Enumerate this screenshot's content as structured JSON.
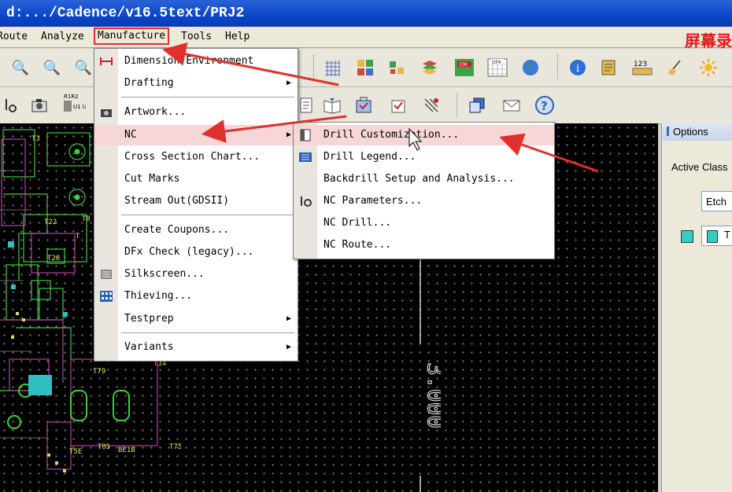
{
  "window": {
    "title": "d:.../Cadence/v16.5text/PRJ2"
  },
  "menubar": {
    "items": [
      "Route",
      "Analyze",
      "Manufacture",
      "Tools",
      "Help"
    ],
    "active": "Manufacture",
    "ad_text": "屏幕录"
  },
  "manufacture_menu": {
    "items": [
      {
        "label": "Dimension Environment",
        "icon": "dimension-icon",
        "submenu": false
      },
      {
        "label": "Drafting",
        "icon": "",
        "submenu": true
      },
      {
        "label": "Artwork...",
        "icon": "camera-icon",
        "submenu": false
      },
      {
        "label": "NC",
        "icon": "",
        "submenu": true
      },
      {
        "label": "Cross Section Chart...",
        "icon": "",
        "submenu": false
      },
      {
        "label": "Cut Marks",
        "icon": "",
        "submenu": false
      },
      {
        "label": "Stream Out(GDSII)",
        "icon": "",
        "submenu": false
      },
      {
        "label": "Create Coupons...",
        "icon": "",
        "submenu": false
      },
      {
        "label": "DFx Check (legacy)...",
        "icon": "",
        "submenu": false
      },
      {
        "label": "Silkscreen...",
        "icon": "silkscreen-icon",
        "submenu": false
      },
      {
        "label": "Thieving...",
        "icon": "thieving-icon",
        "submenu": false
      },
      {
        "label": "Testprep",
        "icon": "",
        "submenu": true
      },
      {
        "label": "Variants",
        "icon": "",
        "submenu": true
      }
    ]
  },
  "nc_submenu": {
    "items": [
      {
        "label": "Drill Customization...",
        "icon": "drill-custom-icon"
      },
      {
        "label": "Drill Legend...",
        "icon": "drill-legend-icon"
      },
      {
        "label": "Backdrill Setup and Analysis...",
        "icon": ""
      },
      {
        "label": "NC Parameters...",
        "icon": "nc-params-icon"
      },
      {
        "label": "NC Drill...",
        "icon": ""
      },
      {
        "label": "NC Route...",
        "icon": ""
      }
    ]
  },
  "options_panel": {
    "title": "Options",
    "active_class_label": "Active Class",
    "class_value": "Etch",
    "subclass_value": "T"
  },
  "toolbar": {
    "badges": {
      "cm": "CM",
      "dfa": "DFA",
      "ruler": "123",
      "r1r2": "R1R2",
      "u1u2": "U1 U2"
    }
  },
  "pcb_labels": [
    "T3",
    "T8",
    "T22",
    "T28",
    "T34",
    "T79",
    "T85",
    "T75",
    "T5E",
    "BE1B",
    "T"
  ],
  "canvas_labels": [
    "3.000"
  ],
  "colors": {
    "annotation_arrow": "#e0302b",
    "highlight": "#f6d6d6",
    "canvas": "#000000"
  }
}
